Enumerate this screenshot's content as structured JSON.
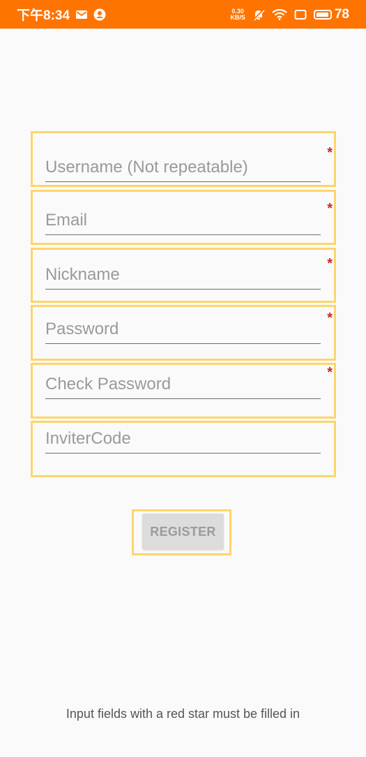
{
  "status_bar": {
    "time": "下午8:34",
    "speed_value": "0.30",
    "speed_unit": "KB/S",
    "battery": "78",
    "icons": [
      "mail-icon",
      "account-icon",
      "mute-icon",
      "wifi-icon",
      "screen-icon",
      "battery-icon"
    ],
    "background": "#ff7300"
  },
  "form": {
    "fields": [
      {
        "placeholder": "Username (Not repeatable)",
        "value": "",
        "required": true
      },
      {
        "placeholder": "Email",
        "value": "",
        "required": true
      },
      {
        "placeholder": "Nickname",
        "value": "",
        "required": true
      },
      {
        "placeholder": "Password",
        "value": "",
        "required": true
      },
      {
        "placeholder": "Check Password",
        "value": "",
        "required": true
      },
      {
        "placeholder": "InviterCode",
        "value": "",
        "required": false
      }
    ],
    "required_marker": "*",
    "register_label": "REGISTER"
  },
  "footer": {
    "note": "Input fields with a red star must be filled in"
  },
  "colors": {
    "highlight_border": "#fdd66a",
    "required_star": "#c62828",
    "button_bg": "#dcdcdc"
  }
}
